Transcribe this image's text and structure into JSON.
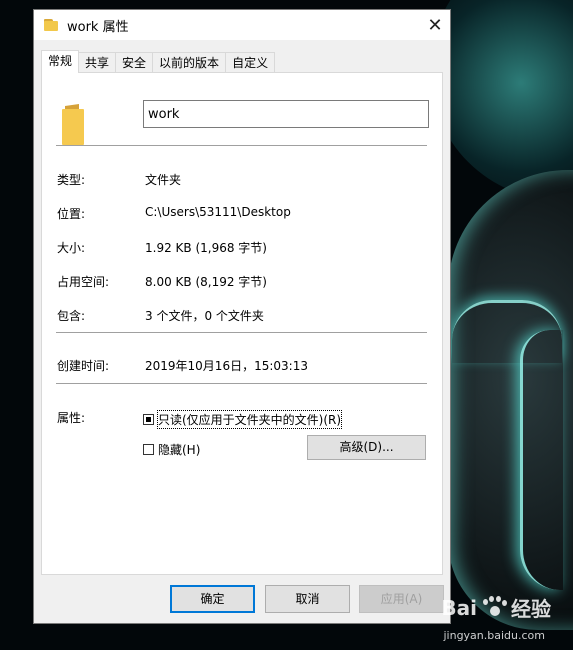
{
  "window": {
    "title": "work 属性",
    "close_glyph": "✕"
  },
  "tabs": [
    {
      "label": "常规",
      "active": true
    },
    {
      "label": "共享",
      "active": false
    },
    {
      "label": "安全",
      "active": false
    },
    {
      "label": "以前的版本",
      "active": false
    },
    {
      "label": "自定义",
      "active": false
    }
  ],
  "general": {
    "name_value": "work",
    "type_label": "类型:",
    "type_value": "文件夹",
    "location_label": "位置:",
    "location_value": "C:\\Users\\53111\\Desktop",
    "size_label": "大小:",
    "size_value": "1.92 KB (1,968 字节)",
    "size_on_disk_label": "占用空间:",
    "size_on_disk_value": "8.00 KB (8,192 字节)",
    "contains_label": "包含:",
    "contains_value": "3 个文件，0 个文件夹",
    "created_label": "创建时间:",
    "created_value": "2019年10月16日，15:03:13",
    "attributes_label": "属性:",
    "readonly_label": "只读(仅应用于文件夹中的文件)(R)",
    "readonly_state": "indeterminate",
    "hidden_label": "隐藏(H)",
    "hidden_state": "unchecked",
    "advanced_label": "高级(D)..."
  },
  "footer": {
    "ok_label": "确定",
    "cancel_label": "取消",
    "apply_label": "应用(A)"
  },
  "watermark": {
    "brand_left": "Bai",
    "brand_right": "经验",
    "url": "jingyan.baidu.com"
  }
}
